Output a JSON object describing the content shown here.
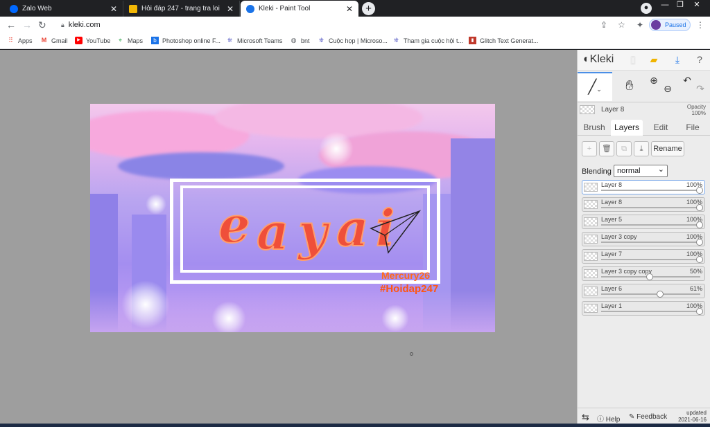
{
  "browser": {
    "tabs": [
      {
        "title": "Zalo Web",
        "active": false,
        "icon_color": "#0068ff"
      },
      {
        "title": "Hỏi đáp 247 - trang tra loi",
        "active": false,
        "icon_color": "#f2b705"
      },
      {
        "title": "Kleki - Paint Tool",
        "active": true,
        "icon_color": "#1a73e8"
      }
    ],
    "url": "kleki.com",
    "profile_status": "Paused",
    "bookmarks": [
      {
        "label": "Apps",
        "icon": "apps-grid-icon"
      },
      {
        "label": "Gmail",
        "icon": "gmail-icon"
      },
      {
        "label": "YouTube",
        "icon": "youtube-icon"
      },
      {
        "label": "Maps",
        "icon": "maps-icon"
      },
      {
        "label": "Photoshop online F...",
        "icon": "photoshop-icon"
      },
      {
        "label": "Microsoft Teams",
        "icon": "teams-icon"
      },
      {
        "label": "bnt",
        "icon": "globe-icon"
      },
      {
        "label": "Cuộc họp | Microso...",
        "icon": "teams-icon"
      },
      {
        "label": "Tham gia cuộc hội t...",
        "icon": "teams-icon"
      },
      {
        "label": "Glitch Text Generat...",
        "icon": "glitch-icon"
      }
    ]
  },
  "canvas": {
    "watermark_line1": "Mercury26",
    "watermark_line2": "#Hoidap247"
  },
  "panel": {
    "logo": "Kleki",
    "current_layer": "Layer 8",
    "opacity_label": "Opacity",
    "opacity_value": "100%",
    "tabs": [
      "Brush",
      "Layers",
      "Edit",
      "File"
    ],
    "active_tab": "Layers",
    "rename_label": "Rename",
    "blending_label": "Blending",
    "blending_value": "normal",
    "layers": [
      {
        "name": "Layer 8",
        "opacity": "100%",
        "level": 1.0,
        "selected": true
      },
      {
        "name": "Layer 8",
        "opacity": "100%",
        "level": 1.0,
        "selected": false
      },
      {
        "name": "Layer 5",
        "opacity": "100%",
        "level": 1.0,
        "selected": false
      },
      {
        "name": "Layer 3 copy",
        "opacity": "100%",
        "level": 1.0,
        "selected": false
      },
      {
        "name": "Layer 7",
        "opacity": "100%",
        "level": 1.0,
        "selected": false
      },
      {
        "name": "Layer 3 copy copy",
        "opacity": "50%",
        "level": 0.5,
        "selected": false
      },
      {
        "name": "Layer 6",
        "opacity": "61%",
        "level": 0.61,
        "selected": false
      },
      {
        "name": "Layer 1",
        "opacity": "100%",
        "level": 1.0,
        "selected": false
      }
    ],
    "footer": {
      "help": "Help",
      "feedback": "Feedback",
      "updated_label": "updated",
      "updated_date": "2021-06-16"
    }
  },
  "colors": {
    "accent": "#1a73e8",
    "watermark": "#ff5511"
  }
}
